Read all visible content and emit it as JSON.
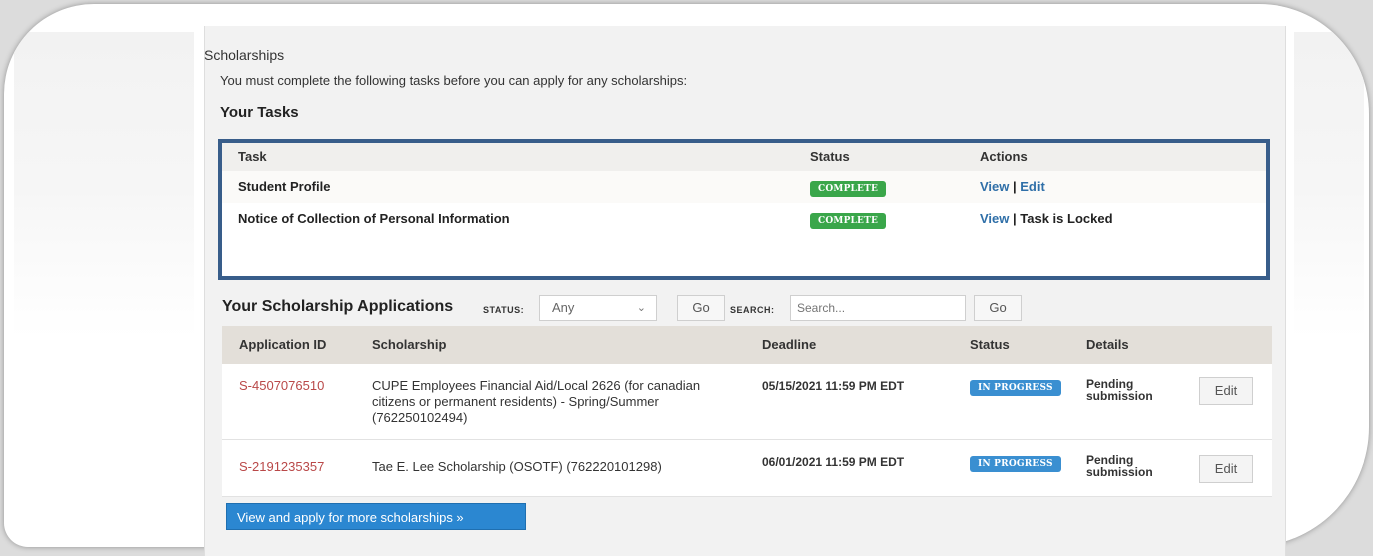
{
  "page": {
    "title": "Scholarships",
    "intro": "You must complete the following tasks before you can apply for any scholarships:",
    "tasks_heading": "Your Tasks"
  },
  "tasks": {
    "headers": {
      "task": "Task",
      "status": "Status",
      "actions": "Actions"
    },
    "rows": [
      {
        "task": "Student Profile",
        "status": "COMPLETE",
        "view": "View",
        "sep": " | ",
        "second": "Edit"
      },
      {
        "task": "Notice of Collection of Personal Information",
        "status": "COMPLETE",
        "view": "View",
        "sep": " | ",
        "second": "Task is Locked"
      }
    ]
  },
  "applications": {
    "heading": "Your Scholarship Applications",
    "status_label": "STATUS:",
    "status_value": "Any",
    "go_label": "Go",
    "search_label": "SEARCH:",
    "search_placeholder": "Search...",
    "headers": {
      "id": "Application ID",
      "scholarship": "Scholarship",
      "deadline": "Deadline",
      "status": "Status",
      "details": "Details"
    },
    "rows": [
      {
        "id": "S-4507076510",
        "scholarship": "CUPE Employees Financial Aid/Local 2626 (for canadian citizens or permanent residents) - Spring/Summer (762250102494)",
        "deadline": "05/15/2021 11:59 PM EDT",
        "status": "IN PROGRESS",
        "details": "Pending submission",
        "edit": "Edit"
      },
      {
        "id": "S-2191235357",
        "scholarship": "Tae E. Lee Scholarship (OSOTF) (762220101298)",
        "deadline": "06/01/2021 11:59 PM EDT",
        "status": "IN PROGRESS",
        "details": "Pending submission",
        "edit": "Edit"
      }
    ],
    "more_button": "View and apply for more scholarships »"
  },
  "colors": {
    "complete_badge": "#3aa64a",
    "in_progress_badge": "#3a8fd1",
    "primary_button": "#2b87d1",
    "highlight_border": "#385d8a",
    "application_id": "#b94848"
  }
}
